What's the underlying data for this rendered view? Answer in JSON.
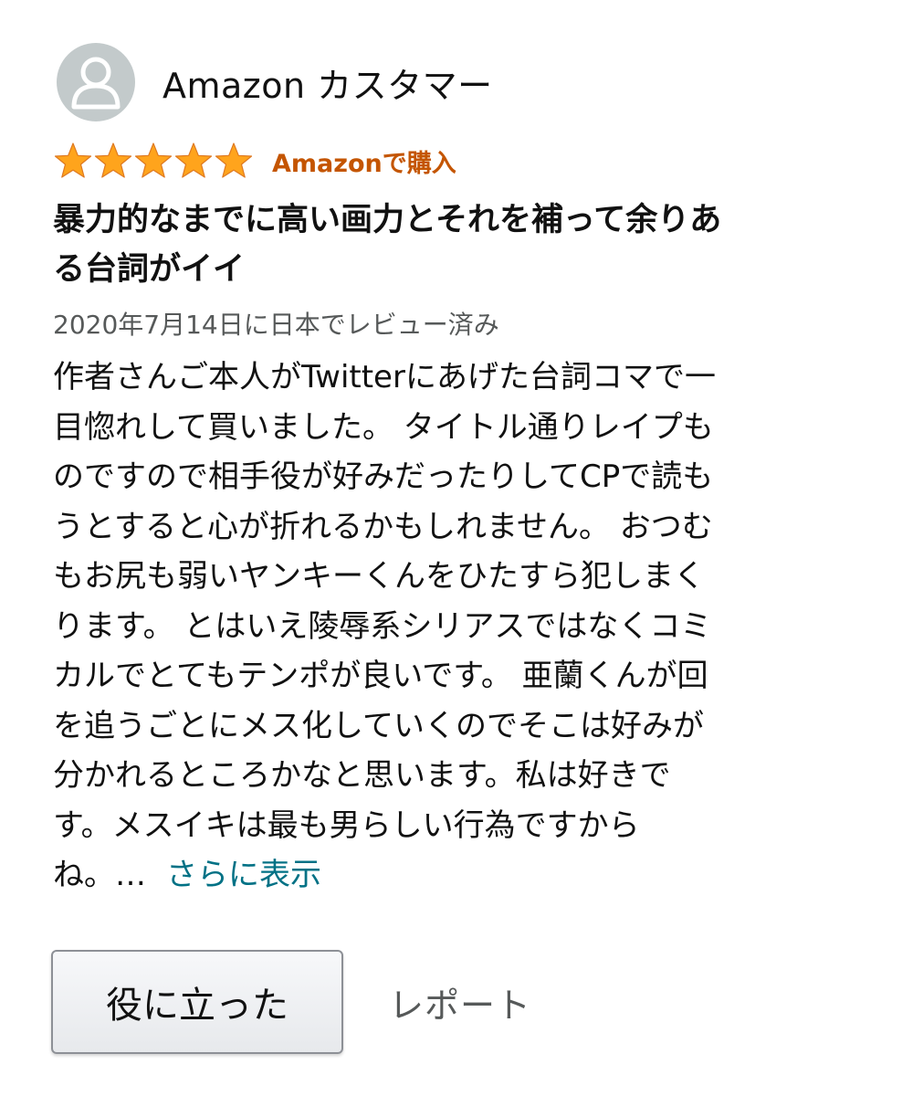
{
  "reviewer": {
    "name": "Amazon カスタマー",
    "avatar_icon": "person-silhouette-icon"
  },
  "rating": {
    "stars": 5,
    "max_stars": 5,
    "star_color": "#FFA41C",
    "verified_label": "Amazonで購入",
    "verified_color": "#C45500"
  },
  "review": {
    "title_lines": [
      "暴力的なまでに高い画力とそれを補って余りあ",
      "る台詞がイイ"
    ],
    "date": "2020年7月14日に日本でレビュー済み",
    "body_lines": [
      "作者さんご本人がTwitterにあげた台詞コマで一",
      "目惚れして買いました。 タイトル通りレイプも",
      "のですので相手役が好みだったりしてCPで読も",
      "うとすると心が折れるかもしれません。 おつむ",
      "もお尻も弱いヤンキーくんをひたすら犯しまく",
      "ります。 とはいえ陵辱系シリアスではなくコミ",
      "カルでとてもテンポが良いです。 亜蘭くんが回",
      "を追うごとにメス化していくのでそこは好みが",
      "分かれるところかなと思います。私は好きで",
      "す。メスイキは最も男らしい行為ですから"
    ],
    "last_line_text": "ね。…",
    "show_more_label": "さらに表示",
    "link_color": "#007185"
  },
  "actions": {
    "helpful_label": "役に立った",
    "report_label": "レポート"
  }
}
